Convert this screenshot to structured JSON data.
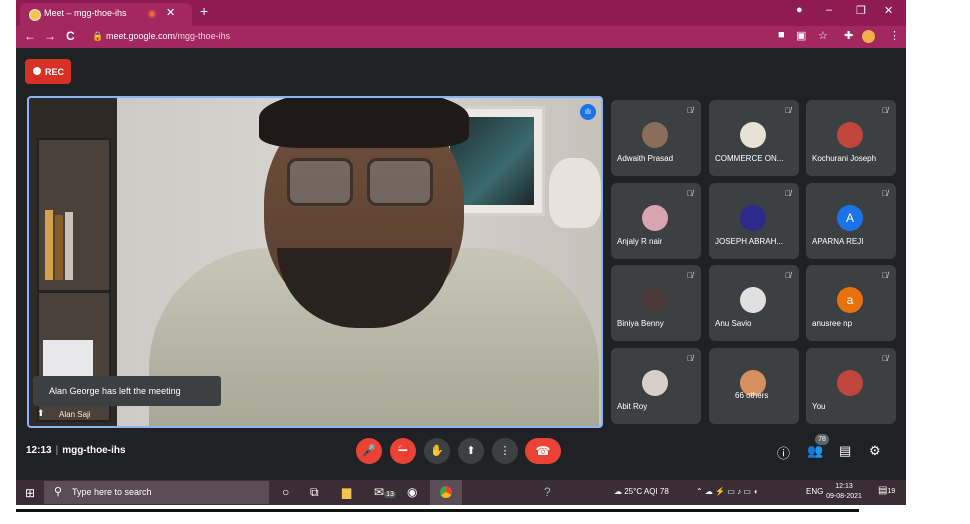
{
  "browser": {
    "tab_title": "Meet – mgg-thoe-ihs",
    "tab_close": "✕",
    "new_tab": "+",
    "window_controls": [
      "●",
      "–",
      "❐",
      "✕"
    ],
    "nav": [
      "←",
      "→",
      "C"
    ],
    "url_host": "meet.google.com",
    "url_path": "/mgg-thoe-ihs",
    "toolbar_icons": [
      "camera-icon",
      "translate-icon",
      "star-icon",
      "extensions-icon",
      "profile-icon",
      "menu-icon"
    ]
  },
  "meet": {
    "rec_label": "REC",
    "toast": "Alan George has left the meeting",
    "speaker_name": "Alan Saji",
    "time": "12:13",
    "room": "mgg-thoe-ihs",
    "people_count": "78",
    "participants": [
      {
        "name": "Adwaith Prasad",
        "color": "#8b6e5a",
        "initial": ""
      },
      {
        "name": "COMMERCE ON...",
        "color": "#e8e2d5",
        "initial": ""
      },
      {
        "name": "Kochurani Joseph",
        "color": "#c0463c",
        "initial": ""
      },
      {
        "name": "Anjaly R nair",
        "color": "#d9a3b2",
        "initial": ""
      },
      {
        "name": "JOSEPH ABRAH...",
        "color": "#2c2a8a",
        "initial": ""
      },
      {
        "name": "APARNA REJI",
        "color": "#1a73e8",
        "initial": "A"
      },
      {
        "name": "Biniya Benny",
        "color": "#4a3a3a",
        "initial": ""
      },
      {
        "name": "Anu Savio",
        "color": "#e0e0e0",
        "initial": ""
      },
      {
        "name": "anusree np",
        "color": "#e8710a",
        "initial": "a"
      },
      {
        "name": "Abit Roy",
        "color": "#d8d0c8",
        "initial": ""
      },
      {
        "name": "66 others",
        "color": "#d69060",
        "initial": ""
      },
      {
        "name": "You",
        "color": "#c0463c",
        "initial": ""
      }
    ]
  },
  "taskbar": {
    "search_placeholder": "Type here to search",
    "weather": "25°C AQI 78",
    "lang": "ENG",
    "clock_time": "12:13",
    "clock_date": "09-08-2021",
    "notif_count": "19",
    "mail_badge": "13"
  }
}
